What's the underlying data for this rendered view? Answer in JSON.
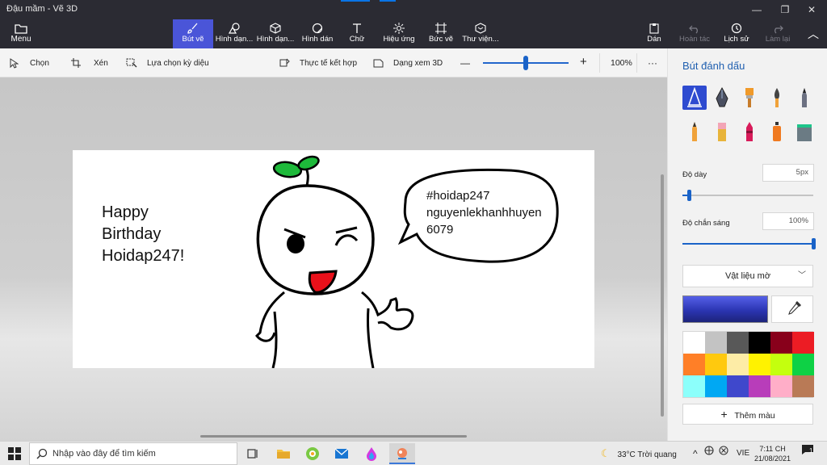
{
  "window": {
    "title": "Đậu mầm - Vẽ 3D",
    "controls": [
      "—",
      "❐",
      "✕"
    ]
  },
  "ribbon": {
    "menu_label": "Menu",
    "tools": [
      {
        "label": "Bút vẽ",
        "icon": "brush-icon",
        "active": true
      },
      {
        "label": "Hình dạn...",
        "icon": "2d-shapes-icon"
      },
      {
        "label": "Hình dạn...",
        "icon": "3d-shapes-icon"
      },
      {
        "label": "Hình dán",
        "icon": "stickers-icon"
      },
      {
        "label": "Chữ",
        "icon": "text-icon"
      },
      {
        "label": "Hiệu ứng",
        "icon": "effects-icon"
      },
      {
        "label": "Bức vẽ",
        "icon": "canvas-icon"
      },
      {
        "label": "Thư viện...",
        "icon": "3d-library-icon"
      }
    ],
    "right": [
      {
        "label": "Dán",
        "icon": "paste-icon",
        "disabled": false
      },
      {
        "label": "Hoàn tác",
        "icon": "undo-icon",
        "disabled": true
      },
      {
        "label": "Lịch sử",
        "icon": "history-icon",
        "disabled": false
      },
      {
        "label": "Làm lại",
        "icon": "redo-icon",
        "disabled": true
      }
    ]
  },
  "toolbar": {
    "select": "Chọn",
    "crop": "Xén",
    "magic_select": "Lựa chọn kỳ diệu",
    "mixed_reality": "Thực tế kết hợp",
    "view_3d": "Dạng xem 3D",
    "zoom_minus": "—",
    "zoom_plus": "+",
    "zoom": "100%",
    "zoom_level": 0.5,
    "more": "···"
  },
  "canvas": {
    "greeting": [
      "Happy",
      "Birthday",
      "Hoidap247!"
    ],
    "bubble": [
      "#hoidap247",
      "nguyenlekhanhhuyen",
      "6079"
    ]
  },
  "panel": {
    "title": "Bút đánh dấu",
    "thickness_label": "Độ dày",
    "thickness_value": "5px",
    "thickness_level": 0.05,
    "opacity_label": "Độ chắn sáng",
    "opacity_value": "100%",
    "opacity_level": 1.0,
    "material": "Vật liệu mờ",
    "current_color": "#2b35b2",
    "palette": [
      "#ffffff",
      "#c3c3c3",
      "#585858",
      "#000000",
      "#88001b",
      "#ec1c24",
      "#ff7f27",
      "#ffc90e",
      "#fdeca6",
      "#fff200",
      "#c4ff0e",
      "#0ed145",
      "#8cfffb",
      "#00a8f3",
      "#3f48cc",
      "#b83dba",
      "#ffaec8",
      "#b97a56"
    ],
    "add_color": "Thêm màu"
  },
  "taskbar": {
    "search_placeholder": "Nhập vào đây để tìm kiếm",
    "weather": "33°C  Trời quang",
    "lang": "VIE",
    "time": "7:11 CH",
    "date": "21/08/2021",
    "notif_count": "1"
  }
}
